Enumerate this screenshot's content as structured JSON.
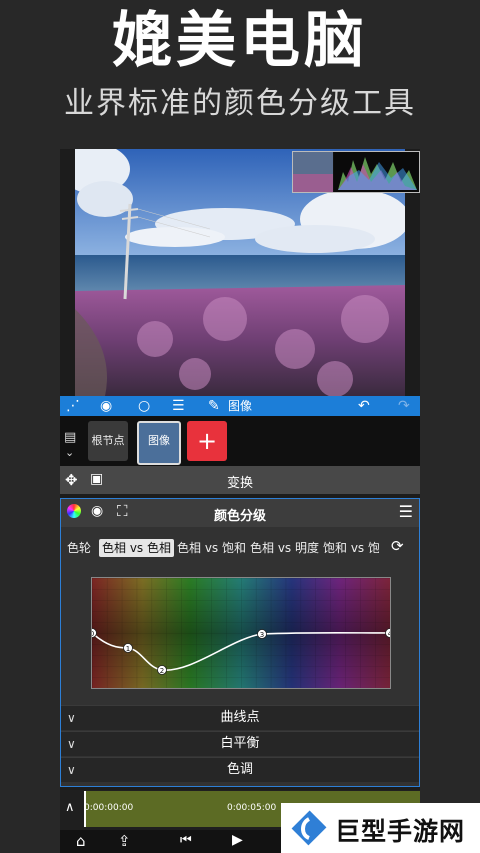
{
  "hero": {
    "title": "媲美电脑",
    "subtitle": "业界标准的颜色分级工具"
  },
  "toolbar": {
    "node_label": "图像"
  },
  "node_bar": {
    "root_node": "根节点",
    "image_node": "图像",
    "add_label": "+"
  },
  "transform": {
    "label": "变换"
  },
  "color_grading": {
    "title": "颜色分级",
    "tabs": [
      "色轮",
      "色相 vs 色相",
      "色相 vs 饱和",
      "色相 vs 明度",
      "饱和 vs 饱和"
    ],
    "active_tab": "色相 vs 色相",
    "curve_points": [
      "0",
      "1",
      "2",
      "3",
      "4"
    ],
    "sections": [
      "曲线点",
      "白平衡",
      "色调"
    ]
  },
  "timeline": {
    "start_time": "0:00:00:00",
    "mid_time": "0:00:05:00"
  },
  "watermark": {
    "text": "巨型手游网"
  },
  "colors": {
    "accent_blue": "#1c7ed8",
    "add_red": "#e8323c",
    "track_green": "#5c6b24"
  }
}
